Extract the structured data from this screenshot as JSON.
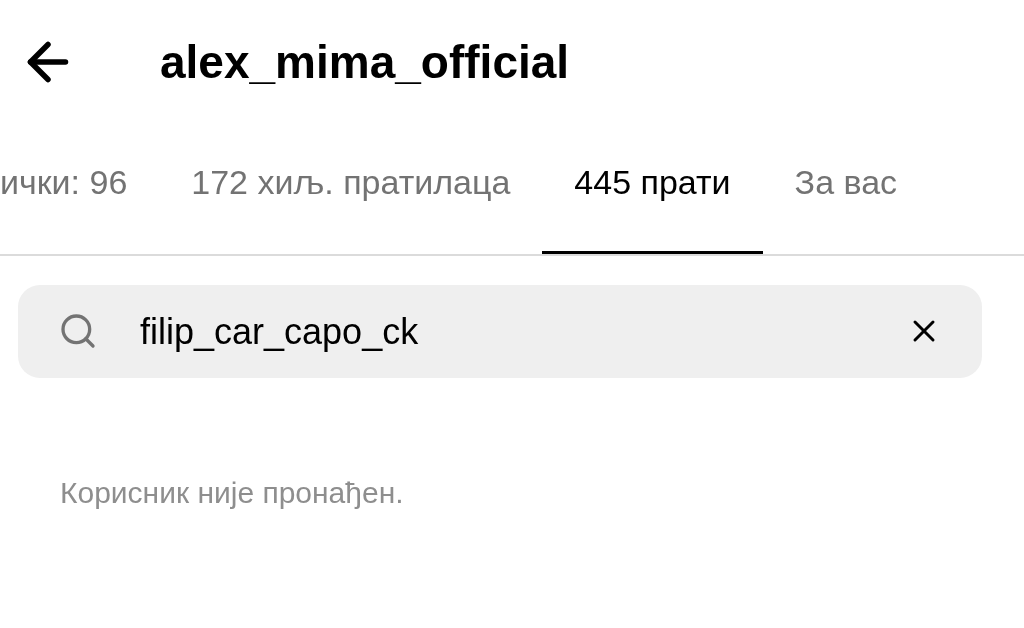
{
  "header": {
    "title": "alex_mima_official"
  },
  "tabs": [
    {
      "label": "ички: 96",
      "selected": false
    },
    {
      "label": "172 хиљ. пратилаца",
      "selected": false
    },
    {
      "label": "445 прати",
      "selected": true
    },
    {
      "label": "За вас",
      "selected": false
    }
  ],
  "search": {
    "value": "filip_car_capo_ck"
  },
  "message": "Корисник није пронађен."
}
